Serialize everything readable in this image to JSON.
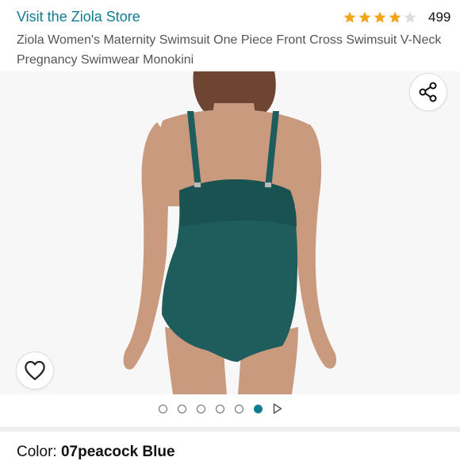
{
  "header": {
    "store_link": "Visit the Ziola Store",
    "rating_stars": 4,
    "rating_max": 5,
    "rating_count": "499",
    "title": "Ziola Women's Maternity Swimsuit One Piece Front Cross Swimsuit V-Neck Pregnancy Swimwear Monokini"
  },
  "gallery": {
    "total_images": 6,
    "active_index": 5,
    "icons": {
      "share": "share-icon",
      "wishlist": "heart-icon",
      "next": "play-arrow-icon"
    }
  },
  "color": {
    "label": "Color: ",
    "value": "07peacock Blue"
  },
  "colors": {
    "link": "#0f7c90",
    "star": "#f1a51b",
    "swimsuit": "#1f5c5c",
    "skin": "#c99a7e"
  }
}
